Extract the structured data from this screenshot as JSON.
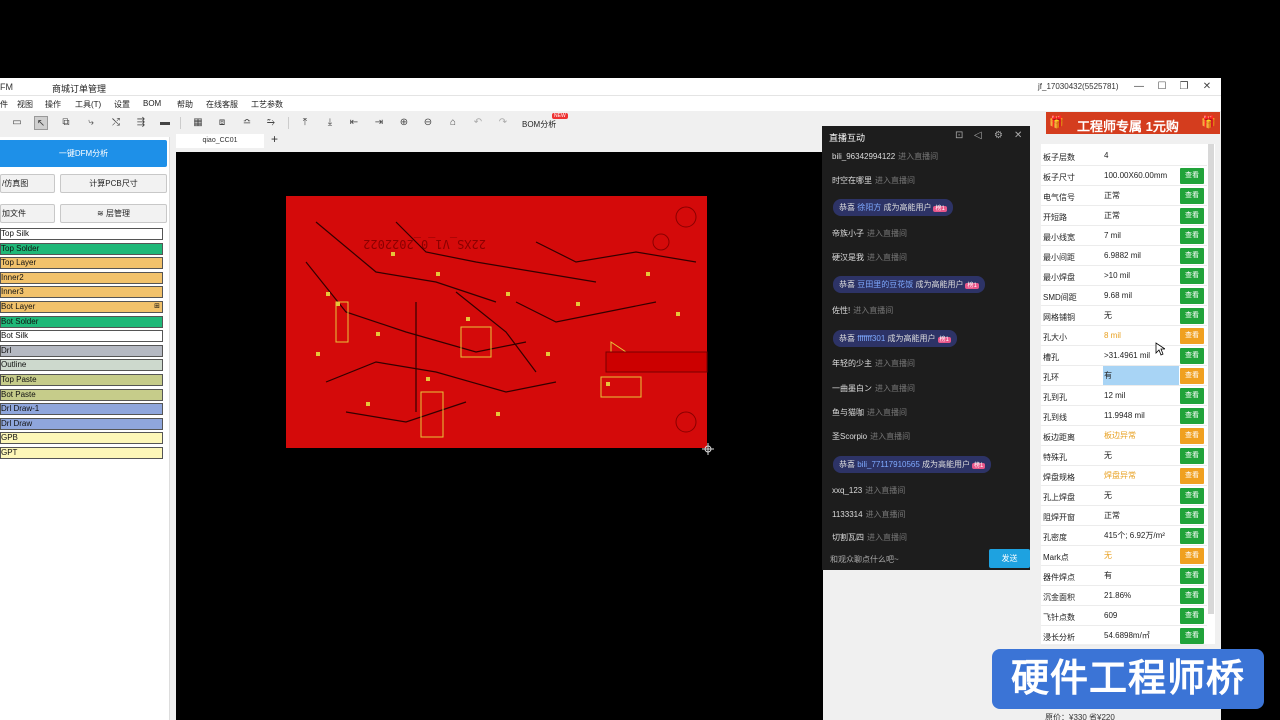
{
  "window": {
    "app_name": "FM",
    "tab_order": "商城订单管理",
    "user": "jf_17030432(5525781)",
    "controls": {
      "minimize": "—",
      "maximize": "☐",
      "restore": "❐",
      "close": "✕"
    }
  },
  "menu": [
    "件",
    "视图",
    "操作",
    "工具(T)",
    "设置",
    "BOM",
    "帮助",
    "在线客服",
    "工艺参数"
  ],
  "toolbar": {
    "bom_label": "BOM分析",
    "bom_badge": "NEW"
  },
  "left": {
    "dfm_button": "一键DFM分析",
    "sim_button": "/仿真图",
    "pcb_size_button": "计算PCB尺寸",
    "add_file_button": "加文件",
    "layer_mgr_button": "≋ 层管理",
    "layers": [
      {
        "name": "Top Silk",
        "color": "#ffffff"
      },
      {
        "name": "Top Solder",
        "color": "#1fb878"
      },
      {
        "name": "Top Layer",
        "color": "#f2c26b"
      },
      {
        "name": "Inner2",
        "color": "#f2c26b"
      },
      {
        "name": "Inner3",
        "color": "#f2c26b"
      },
      {
        "name": "Bot Layer",
        "color": "#f2c26b",
        "expand": "⊞"
      },
      {
        "name": "Bot Solder",
        "color": "#1fb878"
      },
      {
        "name": "Bot Silk",
        "color": "#ffffff"
      },
      {
        "name": "Drl",
        "color": "#b5b9c2"
      },
      {
        "name": "Outline",
        "color": "#cdd9cd"
      },
      {
        "name": "Top Paste",
        "color": "#c6cc8a"
      },
      {
        "name": "Bot Paste",
        "color": "#c6cc8a"
      },
      {
        "name": "Drl Draw-1",
        "color": "#8fa6dc"
      },
      {
        "name": "Drl Draw",
        "color": "#8fa6dc"
      },
      {
        "name": "GPB",
        "color": "#fdf7b8"
      },
      {
        "name": "GPT",
        "color": "#fdf7b8"
      }
    ]
  },
  "canvas": {
    "tab": "qiao_CC01",
    "add": "+",
    "board_text": "22XS_V1_0_2022022"
  },
  "chat": {
    "title": "直播互动",
    "input_placeholder": "和观众聊点什么吧~",
    "send": "发送",
    "messages": [
      {
        "kind": "enter",
        "user": "bili_96342994122",
        "text": "进入直播间"
      },
      {
        "kind": "enter",
        "user": "时空在哪里",
        "text": "进入直播间"
      },
      {
        "kind": "gift",
        "prefix": "恭喜",
        "user": "徐阳方",
        "text": "成为高能用户",
        "tag": "榜1"
      },
      {
        "kind": "enter",
        "user": "帝族小子",
        "text": "进入直播间"
      },
      {
        "kind": "enter",
        "user": "硬汉是我",
        "text": "进入直播间"
      },
      {
        "kind": "gift",
        "prefix": "恭喜",
        "user": "豆田里的豆花饭",
        "text": "成为高能用户",
        "tag": "榜1"
      },
      {
        "kind": "enter",
        "user": "佐性!",
        "text": "进入直播间"
      },
      {
        "kind": "gift",
        "prefix": "恭喜",
        "user": "fffffff301",
        "text": "成为高能用户",
        "tag": "榜1"
      },
      {
        "kind": "enter",
        "user": "年轻的少主",
        "text": "进入直播间"
      },
      {
        "kind": "enter",
        "user": "一曲墨白ン",
        "text": "进入直播间"
      },
      {
        "kind": "enter",
        "user": "鱼与猫咖",
        "text": "进入直播间"
      },
      {
        "kind": "enter",
        "user": "圣Scorpio",
        "text": "进入直播间"
      },
      {
        "kind": "gift",
        "prefix": "恭喜",
        "user": "bili_77117910565",
        "text": "成为高能用户",
        "tag": "榜1"
      },
      {
        "kind": "enter",
        "user": "xxq_123",
        "text": "进入直播间"
      },
      {
        "kind": "enter",
        "user": "1133314",
        "text": "进入直播间"
      },
      {
        "kind": "enter",
        "user": "切割瓦四",
        "text": "进入直播间"
      }
    ]
  },
  "promo": {
    "text": "工程师专属 1元购"
  },
  "right": {
    "rows": [
      {
        "k": "板子层数",
        "v": "4",
        "btn": ""
      },
      {
        "k": "板子尺寸",
        "v": "100.00X60.00mm",
        "btn": "查看"
      },
      {
        "k": "电气信号",
        "v": "正常",
        "btn": "查看"
      },
      {
        "k": "开短路",
        "v": "正常",
        "btn": "查看"
      },
      {
        "k": "最小线宽",
        "v": "7 mil",
        "btn": "查看"
      },
      {
        "k": "最小间距",
        "v": "6.9882 mil",
        "btn": "查看"
      },
      {
        "k": "最小焊盘",
        "v": ">10 mil",
        "btn": "查看"
      },
      {
        "k": "SMD间距",
        "v": "9.68 mil",
        "btn": "查看"
      },
      {
        "k": "网格铺铜",
        "v": "无",
        "btn": "查看"
      },
      {
        "k": "孔大小",
        "v": "8 mil",
        "btn": "查看",
        "warn": true
      },
      {
        "k": "槽孔",
        "v": ">31.4961 mil",
        "btn": "查看"
      },
      {
        "k": "孔环",
        "v": "有",
        "btn": "查看",
        "warn": true,
        "hl": true
      },
      {
        "k": "孔到孔",
        "v": "12 mil",
        "btn": "查看"
      },
      {
        "k": "孔到线",
        "v": "11.9948 mil",
        "btn": "查看"
      },
      {
        "k": "板边距离",
        "v": "板边异常",
        "btn": "查看",
        "warn": true
      },
      {
        "k": "特殊孔",
        "v": "无",
        "btn": "查看"
      },
      {
        "k": "焊盘规格",
        "v": "焊盘异常",
        "btn": "查看",
        "warn": true
      },
      {
        "k": "孔上焊盘",
        "v": "无",
        "btn": "查看"
      },
      {
        "k": "阻焊开窗",
        "v": "正常",
        "btn": "查看"
      },
      {
        "k": "孔密度",
        "v": "415个; 6.92万/m²",
        "btn": "查看"
      },
      {
        "k": "Mark点",
        "v": "无",
        "btn": "查看",
        "warn": true
      },
      {
        "k": "器件焊点",
        "v": "有",
        "btn": "查看"
      },
      {
        "k": "沉金面积",
        "v": "21.86%",
        "btn": "查看"
      },
      {
        "k": "飞针点数",
        "v": "609",
        "btn": "查看"
      },
      {
        "k": "浸长分析",
        "v": "54.6898m/㎡",
        "btn": "查看"
      }
    ],
    "price": "原价：¥330 省¥220"
  },
  "watermark": "硬件工程师桥"
}
